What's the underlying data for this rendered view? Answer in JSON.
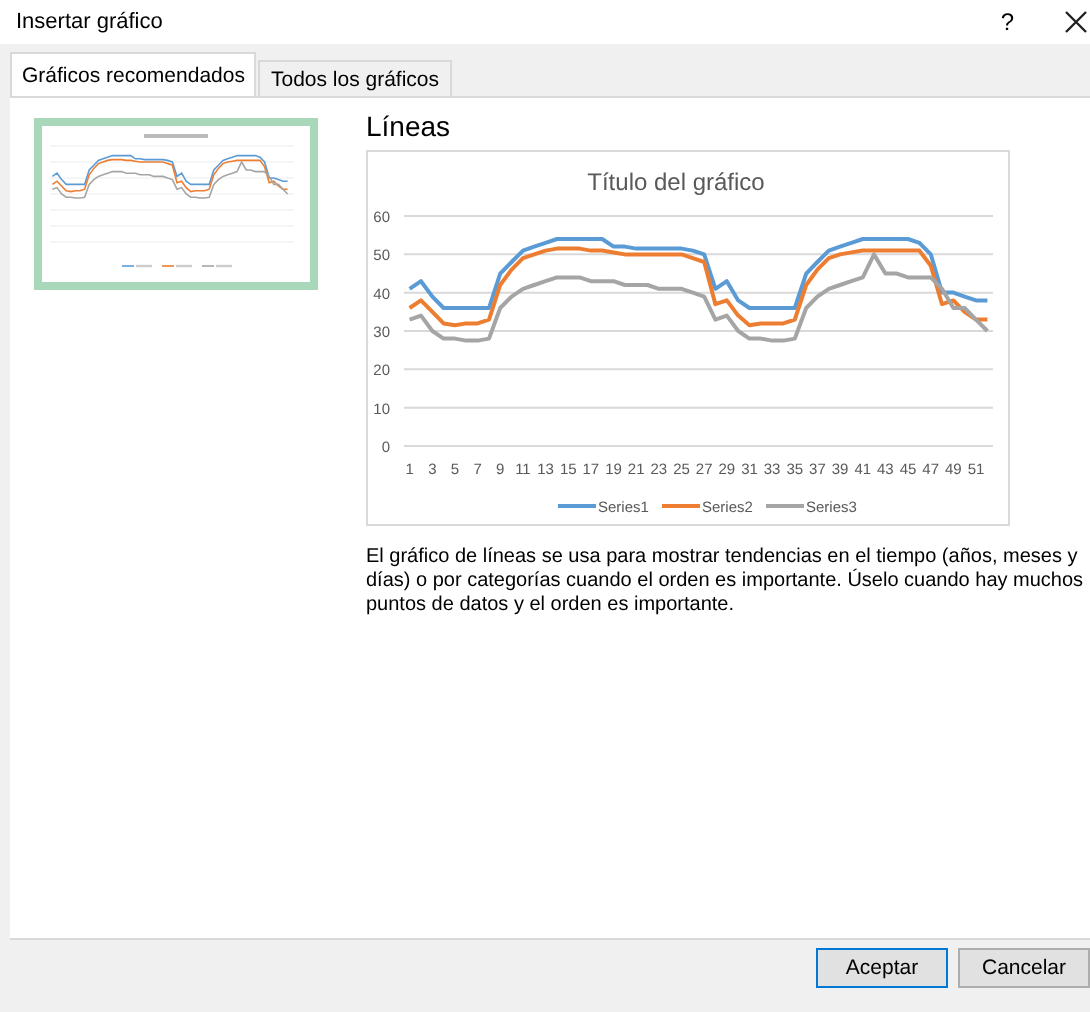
{
  "window": {
    "title": "Insertar gráfico",
    "help": "?"
  },
  "tabs": [
    {
      "label": "Gráficos recomendados",
      "selected": true
    },
    {
      "label": "Todos los gráficos",
      "selected": false
    }
  ],
  "thumbnails": [
    {
      "selected": true
    }
  ],
  "heading": "Líneas",
  "chart_data": {
    "type": "line",
    "title": "Título del gráfico",
    "x": [
      1,
      2,
      3,
      4,
      5,
      6,
      7,
      8,
      9,
      10,
      11,
      12,
      13,
      14,
      15,
      16,
      17,
      18,
      19,
      20,
      21,
      22,
      23,
      24,
      25,
      26,
      27,
      28,
      29,
      30,
      31,
      32,
      33,
      34,
      35,
      36,
      37,
      38,
      39,
      40,
      41,
      42,
      43,
      44,
      45,
      46,
      47,
      48,
      49,
      50,
      51,
      52
    ],
    "xlim": [
      0.5,
      52.5
    ],
    "ylim": [
      0,
      60
    ],
    "grid": true,
    "legend": "bottom",
    "yticks": [
      0,
      10,
      20,
      30,
      40,
      50,
      60
    ],
    "xticks": [
      1,
      3,
      5,
      7,
      9,
      11,
      13,
      15,
      17,
      19,
      21,
      23,
      25,
      27,
      29,
      31,
      33,
      35,
      37,
      39,
      41,
      43,
      45,
      47,
      49,
      51
    ],
    "series": [
      {
        "name": "Series1",
        "color": "#5b9bd5",
        "values": [
          41,
          43,
          39,
          36,
          36,
          36,
          36,
          36,
          45,
          48,
          51,
          52,
          53,
          54,
          54,
          54,
          54,
          54,
          52,
          52,
          51.5,
          51.5,
          51.5,
          51.5,
          51.5,
          51,
          50,
          41,
          43,
          38,
          36,
          36,
          36,
          36,
          36,
          45,
          48,
          51,
          52,
          53,
          54,
          54,
          54,
          54,
          54,
          53,
          50,
          40,
          40,
          39,
          38,
          38
        ]
      },
      {
        "name": "Series2",
        "color": "#ed7d31",
        "values": [
          36,
          38,
          35,
          32,
          31.5,
          32,
          32,
          33,
          42,
          46,
          49,
          50,
          51,
          51.5,
          51.5,
          51.5,
          51,
          51,
          50.5,
          50,
          50,
          50,
          50,
          50,
          50,
          49,
          48,
          37,
          38,
          34,
          31.5,
          32,
          32,
          32,
          33,
          42,
          46,
          49,
          50,
          50.5,
          51,
          51,
          51,
          51,
          51,
          51,
          47,
          37,
          38,
          35,
          33,
          33
        ]
      },
      {
        "name": "Series3",
        "color": "#a5a5a5",
        "values": [
          33,
          34,
          30,
          28,
          28,
          27.5,
          27.5,
          28,
          36,
          39,
          41,
          42,
          43,
          44,
          44,
          44,
          43,
          43,
          43,
          42,
          42,
          42,
          41,
          41,
          41,
          40,
          39,
          33,
          34,
          30,
          28,
          28,
          27.5,
          27.5,
          28,
          36,
          39,
          41,
          42,
          43,
          44,
          50,
          45,
          45,
          44,
          44,
          44,
          41,
          36,
          36,
          33,
          30
        ]
      }
    ]
  },
  "description": "El gráfico de líneas se usa para mostrar tendencias en el tiempo (años, meses y días) o por categorías cuando el orden es importante. Úselo cuando hay muchos puntos de datos y el orden es importante.",
  "buttons": [
    {
      "label": "Aceptar",
      "default": true
    },
    {
      "label": "Cancelar",
      "default": false
    }
  ]
}
